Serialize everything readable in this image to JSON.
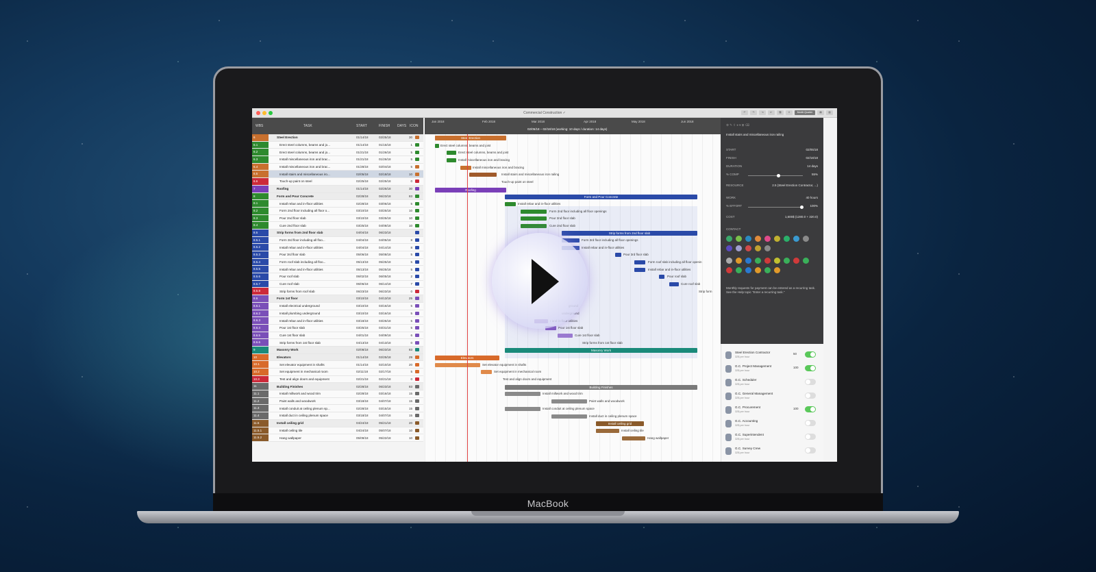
{
  "app": {
    "window_title": "Commercial Construction ✓",
    "toolbar_buttons": [
      "Month Quarter"
    ],
    "device_brand": "MacBook"
  },
  "grid": {
    "headers": {
      "wbs": "WBS",
      "task": "TASK",
      "start": "START",
      "finish": "FINISH",
      "days": "DAYS",
      "icon": "ICON"
    },
    "rows": [
      {
        "wbs": "6",
        "name": "Steel Erection",
        "start": "01/14/18",
        "finish": "02/25/18",
        "days": "30",
        "color": "#c8702e",
        "summary": true
      },
      {
        "wbs": "6.1",
        "name": "Erect steel columns, beams and jo...",
        "start": "01/14/18",
        "finish": "01/15/18",
        "days": "1",
        "color": "#2e8a2e"
      },
      {
        "wbs": "6.2",
        "name": "Erect steel columns, beams and jo...",
        "start": "01/21/18",
        "finish": "01/26/18",
        "days": "5",
        "color": "#2e8a2e"
      },
      {
        "wbs": "6.3",
        "name": "Install miscellaneous iron and brac...",
        "start": "01/21/18",
        "finish": "01/26/18",
        "days": "5",
        "color": "#2e8a2e"
      },
      {
        "wbs": "6.4",
        "name": "Install miscellaneous iron and brac...",
        "start": "01/28/18",
        "finish": "02/04/18",
        "days": "5",
        "color": "#c8702e"
      },
      {
        "wbs": "6.5",
        "name": "Install stairs and miscellaneous iro...",
        "start": "02/05/18",
        "finish": "02/18/18",
        "days": "10",
        "color": "#c8702e",
        "selected": true
      },
      {
        "wbs": "6.6",
        "name": "Touch-up paint on steel",
        "start": "02/25/18",
        "finish": "02/25/18",
        "days": "0",
        "color": "#cc2a3a"
      },
      {
        "wbs": "7",
        "name": "Roofing",
        "start": "01/14/18",
        "finish": "02/25/18",
        "days": "30",
        "color": "#7a3fb8",
        "summary": true
      },
      {
        "wbs": "8",
        "name": "Form and Pour Concrete",
        "start": "02/28/18",
        "finish": "06/23/18",
        "days": "83",
        "color": "#2e8a2e",
        "summary": true
      },
      {
        "wbs": "8.1",
        "name": "Install rebar and in-floor utilities",
        "start": "02/28/18",
        "finish": "03/06/18",
        "days": "5",
        "color": "#2e8a2e"
      },
      {
        "wbs": "8.2",
        "name": "Form 2nd floor including all floor o...",
        "start": "03/10/18",
        "finish": "03/25/18",
        "days": "10",
        "color": "#2e8a2e"
      },
      {
        "wbs": "8.3",
        "name": "Pour 2nd floor slab",
        "start": "03/10/18",
        "finish": "03/25/18",
        "days": "10",
        "color": "#2e8a2e"
      },
      {
        "wbs": "8.4",
        "name": "Cure 2nd floor slab",
        "start": "03/25/18",
        "finish": "04/08/18",
        "days": "10",
        "color": "#2e8a2e"
      },
      {
        "wbs": "8.5",
        "name": "Strip forms from 2nd floor slab",
        "start": "04/04/18",
        "finish": "06/23/18",
        "days": "",
        "color": "#2a4aa8",
        "summary": true
      },
      {
        "wbs": "8.5.1",
        "name": "Form 3rd floor including all floo...",
        "start": "04/04/18",
        "finish": "04/05/18",
        "days": "8",
        "color": "#2a4aa8"
      },
      {
        "wbs": "8.5.2",
        "name": "Install rebar and in-floor utilities",
        "start": "04/04/18",
        "finish": "04/14/18",
        "days": "8",
        "color": "#2a4aa8"
      },
      {
        "wbs": "8.5.3",
        "name": "Pour 3rd floor slab",
        "start": "05/06/18",
        "finish": "05/08/18",
        "days": "5",
        "color": "#2a4aa8"
      },
      {
        "wbs": "8.5.4",
        "name": "Form roof slab including all floo...",
        "start": "05/13/18",
        "finish": "05/25/18",
        "days": "5",
        "color": "#2a4aa8"
      },
      {
        "wbs": "8.5.5",
        "name": "Install rebar and in-floor utilities",
        "start": "05/13/18",
        "finish": "05/25/18",
        "days": "5",
        "color": "#2a4aa8"
      },
      {
        "wbs": "8.5.6",
        "name": "Pour roof slab",
        "start": "06/02/18",
        "finish": "06/05/18",
        "days": "2",
        "color": "#2a4aa8"
      },
      {
        "wbs": "8.5.7",
        "name": "Cure roof slab",
        "start": "06/06/18",
        "finish": "06/14/18",
        "days": "7",
        "color": "#2a4aa8"
      },
      {
        "wbs": "8.5.8",
        "name": "Strip forms from roof slab",
        "start": "06/23/18",
        "finish": "06/23/18",
        "days": "0",
        "color": "#cc2a3a"
      },
      {
        "wbs": "8.6",
        "name": "Form 1st floor",
        "start": "03/10/18",
        "finish": "04/13/18",
        "days": "25",
        "color": "#7a4fb8",
        "summary": true
      },
      {
        "wbs": "8.6.1",
        "name": "Install electrical underground",
        "start": "03/10/18",
        "finish": "03/16/18",
        "days": "5",
        "color": "#7a4fb8"
      },
      {
        "wbs": "8.6.2",
        "name": "Install plumbing underground",
        "start": "03/10/18",
        "finish": "03/16/18",
        "days": "5",
        "color": "#7a4fb8"
      },
      {
        "wbs": "8.6.3",
        "name": "Install rebar and in-floor utilities",
        "start": "03/18/18",
        "finish": "03/25/18",
        "days": "5",
        "color": "#7a4fb8"
      },
      {
        "wbs": "8.6.4",
        "name": "Pour 1st floor slab",
        "start": "03/25/18",
        "finish": "03/31/18",
        "days": "5",
        "color": "#7a4fb8"
      },
      {
        "wbs": "8.6.5",
        "name": "Cure 1st floor slab",
        "start": "04/01/18",
        "finish": "04/09/18",
        "days": "6",
        "color": "#7a4fb8"
      },
      {
        "wbs": "8.6.6",
        "name": "Strip forms from 1st floor slab",
        "start": "04/13/18",
        "finish": "04/13/18",
        "days": "0",
        "color": "#7a4fb8"
      },
      {
        "wbs": "9",
        "name": "Masonry Work",
        "start": "02/08/18",
        "finish": "06/23/18",
        "days": "83",
        "color": "#1a8a7a",
        "summary": true
      },
      {
        "wbs": "10",
        "name": "Elevators",
        "start": "01/14/18",
        "finish": "02/25/18",
        "days": "29",
        "color": "#d86a2a",
        "summary": true
      },
      {
        "wbs": "10.1",
        "name": "Set elevator equipment in shafts",
        "start": "01/14/18",
        "finish": "02/10/18",
        "days": "20",
        "color": "#d86a2a"
      },
      {
        "wbs": "10.2",
        "name": "Set equipment in mechanical room",
        "start": "02/11/18",
        "finish": "02/17/18",
        "days": "5",
        "color": "#d86a2a"
      },
      {
        "wbs": "10.3",
        "name": "Test and align doors and equipment",
        "start": "02/21/18",
        "finish": "02/21/18",
        "days": "0",
        "color": "#cc2a3a"
      },
      {
        "wbs": "11",
        "name": "Building Finishes",
        "start": "02/28/18",
        "finish": "06/23/18",
        "days": "83",
        "color": "#6a6a6a",
        "summary": true
      },
      {
        "wbs": "11.1",
        "name": "Install millwork and wood trim",
        "start": "02/28/18",
        "finish": "03/16/18",
        "days": "15",
        "color": "#6a6a6a"
      },
      {
        "wbs": "11.2",
        "name": "Paint walls and woodwork",
        "start": "03/18/18",
        "finish": "04/07/18",
        "days": "15",
        "color": "#6a6a6a"
      },
      {
        "wbs": "11.3",
        "name": "Install conduit at ceiling plenum sp...",
        "start": "02/28/18",
        "finish": "03/15/18",
        "days": "15",
        "color": "#6a6a6a"
      },
      {
        "wbs": "11.4",
        "name": "Install duct in ceiling plenum space",
        "start": "03/18/18",
        "finish": "04/07/18",
        "days": "15",
        "color": "#6a6a6a"
      },
      {
        "wbs": "11.5",
        "name": "Install ceiling grid",
        "start": "04/24/18",
        "finish": "05/21/18",
        "days": "20",
        "color": "#8a5a2a",
        "summary": true
      },
      {
        "wbs": "11.5.1",
        "name": "Install ceiling tile",
        "start": "04/24/18",
        "finish": "05/07/18",
        "days": "10",
        "color": "#8a5a2a"
      },
      {
        "wbs": "11.5.2",
        "name": "Hang wallpaper",
        "start": "05/09/18",
        "finish": "05/22/18",
        "days": "10",
        "color": "#8a5a2a"
      }
    ]
  },
  "gantt": {
    "months": [
      "Jan 2018",
      "Feb 2018",
      "Mar 2018",
      "Apr 2018",
      "May 2018",
      "Jun 2018"
    ],
    "selection_info": "02/05/18 – 02/18/18 (working: 10 days / duration: 14 days)",
    "summaries": {
      "steel": "Steel Erection",
      "roofing": "Roofing",
      "concrete": "Form and Pour Concrete",
      "strip2": "Strip forms from 2nd floor slab",
      "masonry": "Masonry Work",
      "elevators": "Elevators",
      "finishes": "Building Finishes",
      "ceiling": "Install ceiling grid"
    },
    "labels": {
      "l1": "Erect steel columns, beams and joist",
      "l2": "Erect steel columns, beams and joist",
      "l3": "Install miscellaneous iron and bracing",
      "l4": "Install miscellaneous iron and bracing",
      "l5": "Install stairs and miscellaneous iron railing",
      "l6": "Touch-up paint on steel",
      "l7": "Install rebar and in-floor utilities",
      "l8": "Form 2nd floor including all floor openings",
      "l9": "Pour 2nd floor slab",
      "l10": "Cure 2nd floor slab",
      "l11": "Form 3rd floor including all floor openings",
      "l12": "Install rebar and in-floor utilities",
      "l13": "Pour 3rd floor slab",
      "l14": "Form roof slab including all floor openin",
      "l15": "Install rebar and in-floor utilities",
      "l16": "Pour roof slab",
      "l17": "Cure roof slab",
      "l18": "Strip form",
      "l19": "ground",
      "l20": "underground",
      "l21": "r and in-floor utilities",
      "l22": "Pour 1st floor slab",
      "l23": "Cure 1st floor slab",
      "l24": "Strip forms from 1st floor slab",
      "l25": "Set elevator equipment in shafts",
      "l26": "Set equipment in mechanical room",
      "l27": "Test and align doors and equipment",
      "l28": "Install millwork and wood trim",
      "l29": "Paint walls and woodwork",
      "l30": "Install conduit at ceiling plenum space",
      "l31": "Install duct in ceiling plenum space",
      "l32": "Install ceiling tile",
      "l33": "Hang wallpaper"
    }
  },
  "inspector": {
    "task_title": "Install stairs and miscellaneous iron railing",
    "start_label": "START",
    "start_value": "02/05/18",
    "finish_label": "FINISH",
    "finish_value": "02/18/18",
    "duration_label": "DURATION",
    "duration_value": "14 days",
    "comp_label": "% COMP",
    "comp_value": "55%",
    "comp_fraction": 0.55,
    "resource_label": "RESOURCE",
    "resource_value": "2.5 (Steel Erection Contractor, ...)",
    "work_label": "WORK",
    "work_value": "40 hours",
    "effort_label": "% EFFORT",
    "effort_value": "100%",
    "effort_fraction": 1.0,
    "cost_label": "COST",
    "cost_value": "1,600$ (1280.0 + 320.0)",
    "contact_label": "CONTACT",
    "note": "Monthly requests for payment can be entered as a recurring task. See the Help topic \"Enter a recurring task.\"",
    "swatch_colors": [
      "#3aa86a",
      "#7ac04a",
      "#2a8ac0",
      "#e08a3a",
      "#e04a8a",
      "#c0b030",
      "#2ab06a",
      "#3a9ad0",
      "#8a8a8a",
      "#5a4ac0",
      "#a0a0d0",
      "#d04a4a",
      "#c0a030",
      "#8a8a8a"
    ],
    "status_icon_colors": [
      "#aaaaaa",
      "#e09a2a",
      "#2a7ad0",
      "#3ab05a",
      "#d03a3a",
      "#c0c030",
      "#3ab05a",
      "#d03a3a",
      "#3ab05a",
      "#d03a3a",
      "#3ab05a",
      "#2a7ad0",
      "#e09a2a",
      "#3ab05a",
      "#e09a2a"
    ]
  },
  "resources": [
    {
      "name": "Steel Erection Contractor",
      "rate": "32$ per hour",
      "pct": "50",
      "on": true
    },
    {
      "name": "G.C. Project Management",
      "rate": "32$ per hour",
      "pct": "100",
      "on": true
    },
    {
      "name": "G.C. Scheduler",
      "rate": "32$ per hour",
      "pct": "",
      "on": false
    },
    {
      "name": "G.C. General Management",
      "rate": "32$ per hour",
      "pct": "",
      "on": false
    },
    {
      "name": "G.C. Procurement",
      "rate": "32$ per hour",
      "pct": "100",
      "on": true
    },
    {
      "name": "G.C. Accounting",
      "rate": "32$ per hour",
      "pct": "",
      "on": false
    },
    {
      "name": "G.C. Superintendent",
      "rate": "32$ per hour",
      "pct": "",
      "on": false
    },
    {
      "name": "G.C. Survey Crew",
      "rate": "32$ per hour",
      "pct": "",
      "on": false
    }
  ]
}
